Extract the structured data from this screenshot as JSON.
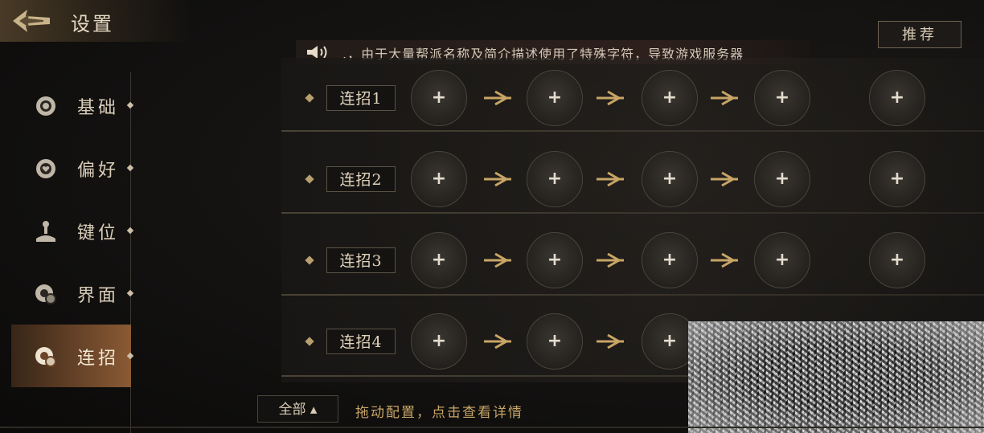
{
  "header": {
    "title": "设置"
  },
  "recommend_label": "推荐",
  "announcement": {
    "text": ".，由于大量帮派名称及简介描述使用了特殊字符，导致游戏服务器"
  },
  "sidebar": {
    "items": [
      {
        "label": "基础",
        "icon": "flower-icon",
        "active": false
      },
      {
        "label": "偏好",
        "icon": "heart-flower-icon",
        "active": false
      },
      {
        "label": "键位",
        "icon": "joystick-icon",
        "active": false
      },
      {
        "label": "界面",
        "icon": "interface-gear-icon",
        "active": false
      },
      {
        "label": "连招",
        "icon": "combo-gear-icon",
        "active": true
      }
    ]
  },
  "combos": [
    {
      "label": "连招1",
      "slot_label": "+"
    },
    {
      "label": "连招2",
      "slot_label": "+"
    },
    {
      "label": "连招3",
      "slot_label": "+"
    },
    {
      "label": "连招4",
      "slot_label": "+"
    }
  ],
  "footer": {
    "filter_label": "全部 ▴",
    "hint": "拖动配置，点击查看详情"
  },
  "colors": {
    "accent_gold": "#c8a566",
    "active_tab": "#8a5a34",
    "background": "#121110"
  }
}
